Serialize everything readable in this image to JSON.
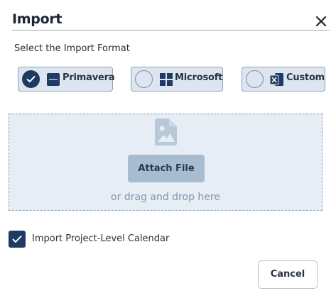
{
  "dialog": {
    "title": "Import",
    "close_icon": "close-icon"
  },
  "format_section": {
    "label": "Select the Import Format",
    "options": [
      {
        "label": "Primavera",
        "icon": "primavera-logo-icon",
        "selected": true
      },
      {
        "label": "Microsoft",
        "icon": "windows-logo-icon",
        "selected": false
      },
      {
        "label": "Custom",
        "icon": "excel-icon",
        "selected": false
      }
    ]
  },
  "dropzone": {
    "icon": "image-file-icon",
    "attach_label": "Attach File",
    "drag_text": "or drag and drop here"
  },
  "calendar_option": {
    "label": "Import Project-Level Calendar",
    "checked": true
  },
  "footer": {
    "cancel_label": "Cancel"
  },
  "colors": {
    "accent": "#1f3a63",
    "option_bg": "#dde6f0",
    "dropzone_bg": "#e6edf5",
    "attach_bg": "#a8bccf"
  }
}
